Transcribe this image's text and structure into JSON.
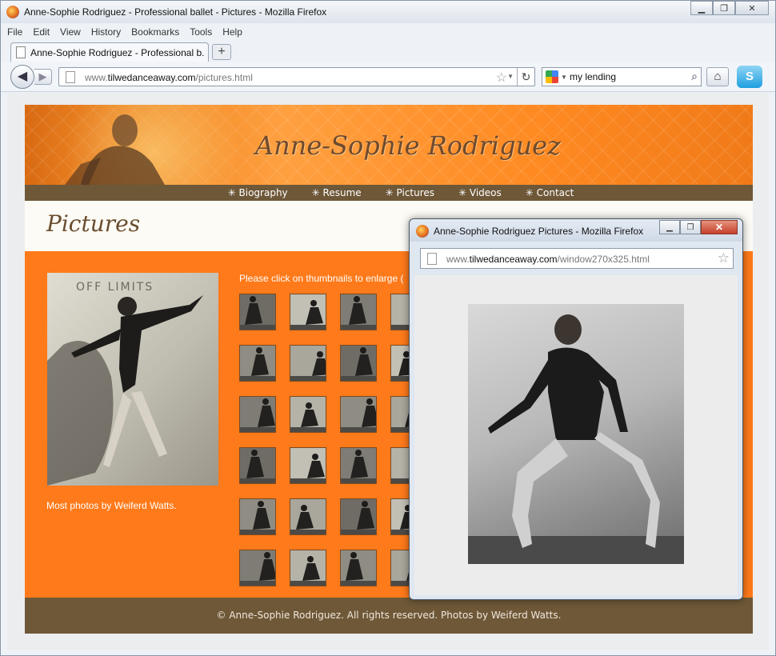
{
  "browser": {
    "window_title": "Anne-Sophie Rodriguez - Professional ballet - Pictures - Mozilla Firefox",
    "menu": [
      "File",
      "Edit",
      "View",
      "History",
      "Bookmarks",
      "Tools",
      "Help"
    ],
    "tab_label": "Anne-Sophie Rodriguez - Professional b...",
    "new_tab": "+",
    "url_prefix": "www.",
    "url_domain": "tilwedanceaway.com",
    "url_path": "/pictures.html",
    "search_value": "my lending"
  },
  "site": {
    "title": "Anne-Sophie Rodriguez",
    "nav": [
      "✳ Biography",
      "✳ Resume",
      "✳ Pictures",
      "✳ Videos",
      "✳ Contact"
    ],
    "page_heading": "Pictures",
    "main_photo_sign": "OFF LIMITS",
    "caption": "Most photos by Weiferd Watts.",
    "instructions": "Please click on thumbnails to enlarge (",
    "footer": "© Anne-Sophie Rodriguez.  All rights reserved.  Photos by Weiferd Watts."
  },
  "popup": {
    "title": "Anne-Sophie Rodriguez Pictures - Mozilla Firefox",
    "url_prefix": "www.",
    "url_domain": "tilwedanceaway.com",
    "url_path": "/window270x325.html"
  }
}
